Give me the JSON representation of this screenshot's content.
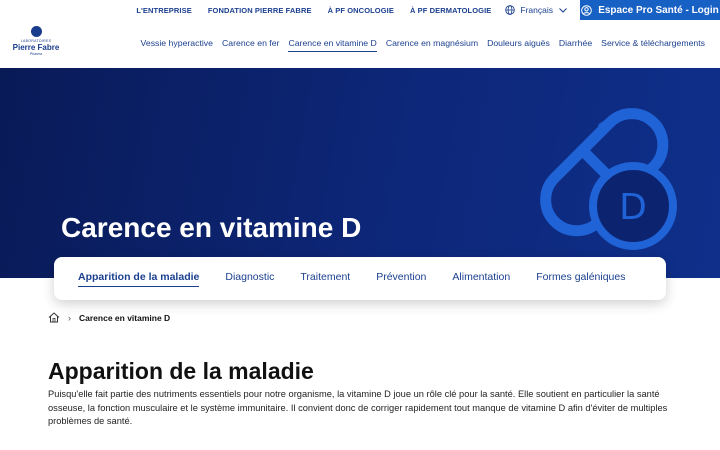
{
  "topbar": {
    "links": [
      "L'ENTREPRISE",
      "FONDATION PIERRE FABRE",
      "À PF ONCOLOGIE",
      "À PF DERMATOLOGIE"
    ],
    "language": "Français",
    "login_label": "Espace Pro Santé - Login"
  },
  "logo": {
    "small": "LABORATOIRES",
    "name": "Pierre Fabre",
    "sub": "Pharma"
  },
  "nav": {
    "items": [
      "Vessie hyperactive",
      "Carence en fer",
      "Carence en vitamine D",
      "Carence en magnésium",
      "Douleurs aiguës",
      "Diarrhée",
      "Service & téléchargements"
    ],
    "active_index": 2
  },
  "hero": {
    "title": "Carence en vitamine D",
    "icon": "vitamin-d-capsule-icon",
    "icon_letter": "D"
  },
  "tabs": {
    "items": [
      "Apparition de la maladie",
      "Diagnostic",
      "Traitement",
      "Prévention",
      "Alimentation",
      "Formes galéniques"
    ],
    "active_index": 0
  },
  "breadcrumb": {
    "home_icon": "home-icon",
    "current": "Carence en vitamine D"
  },
  "content": {
    "title": "Apparition de la maladie",
    "body": "Puisqu'elle fait partie des nutriments essentiels pour notre organisme, la vitamine D joue un rôle clé pour la santé. Elle soutient en particulier la santé osseuse, la fonction musculaire et le système immunitaire. Il convient donc de corriger rapidement tout manque de vitamine D afin d'éviter de multiples problèmes de santé."
  },
  "colors": {
    "brand_blue": "#1b3f8f",
    "login_bg": "#1760c4",
    "hero_dark": "#091a57",
    "hero_icon": "#1f63d6"
  }
}
